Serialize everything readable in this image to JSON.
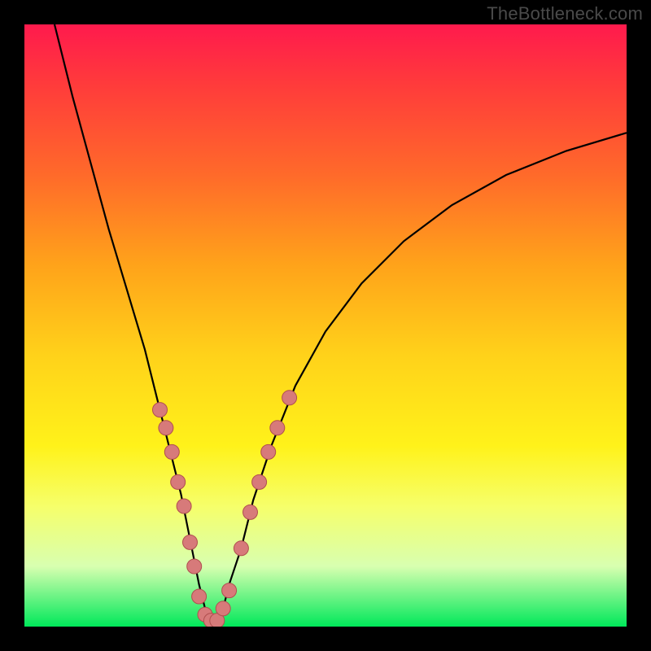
{
  "attribution": "TheBottleneck.com",
  "colors": {
    "frame": "#000000",
    "curve": "#000000",
    "dot_fill": "#d77a7a",
    "dot_stroke": "#b04f4f"
  },
  "chart_data": {
    "type": "line",
    "title": "",
    "xlabel": "",
    "ylabel": "",
    "xlim": [
      0,
      100
    ],
    "ylim": [
      0,
      100
    ],
    "series": [
      {
        "name": "bottleneck-curve",
        "x": [
          5,
          8,
          11,
          14,
          17,
          20,
          22,
          24,
          26,
          27,
          28,
          29,
          30,
          31,
          32,
          33,
          34,
          36,
          38,
          41,
          45,
          50,
          56,
          63,
          71,
          80,
          90,
          100
        ],
        "y": [
          100,
          88,
          77,
          66,
          56,
          46,
          38,
          30,
          22,
          17,
          12,
          7,
          3,
          1,
          1,
          3,
          7,
          13,
          21,
          30,
          40,
          49,
          57,
          64,
          70,
          75,
          79,
          82
        ]
      }
    ],
    "scatter": {
      "name": "highlight-dots",
      "points": [
        {
          "x": 22.5,
          "y": 36
        },
        {
          "x": 23.5,
          "y": 33
        },
        {
          "x": 24.5,
          "y": 29
        },
        {
          "x": 25.5,
          "y": 24
        },
        {
          "x": 26.5,
          "y": 20
        },
        {
          "x": 27.5,
          "y": 14
        },
        {
          "x": 28.2,
          "y": 10
        },
        {
          "x": 29.0,
          "y": 5
        },
        {
          "x": 30.0,
          "y": 2
        },
        {
          "x": 31.0,
          "y": 1
        },
        {
          "x": 32.0,
          "y": 1
        },
        {
          "x": 33.0,
          "y": 3
        },
        {
          "x": 34.0,
          "y": 6
        },
        {
          "x": 36.0,
          "y": 13
        },
        {
          "x": 37.5,
          "y": 19
        },
        {
          "x": 39.0,
          "y": 24
        },
        {
          "x": 40.5,
          "y": 29
        },
        {
          "x": 42.0,
          "y": 33
        },
        {
          "x": 44.0,
          "y": 38
        }
      ]
    }
  }
}
